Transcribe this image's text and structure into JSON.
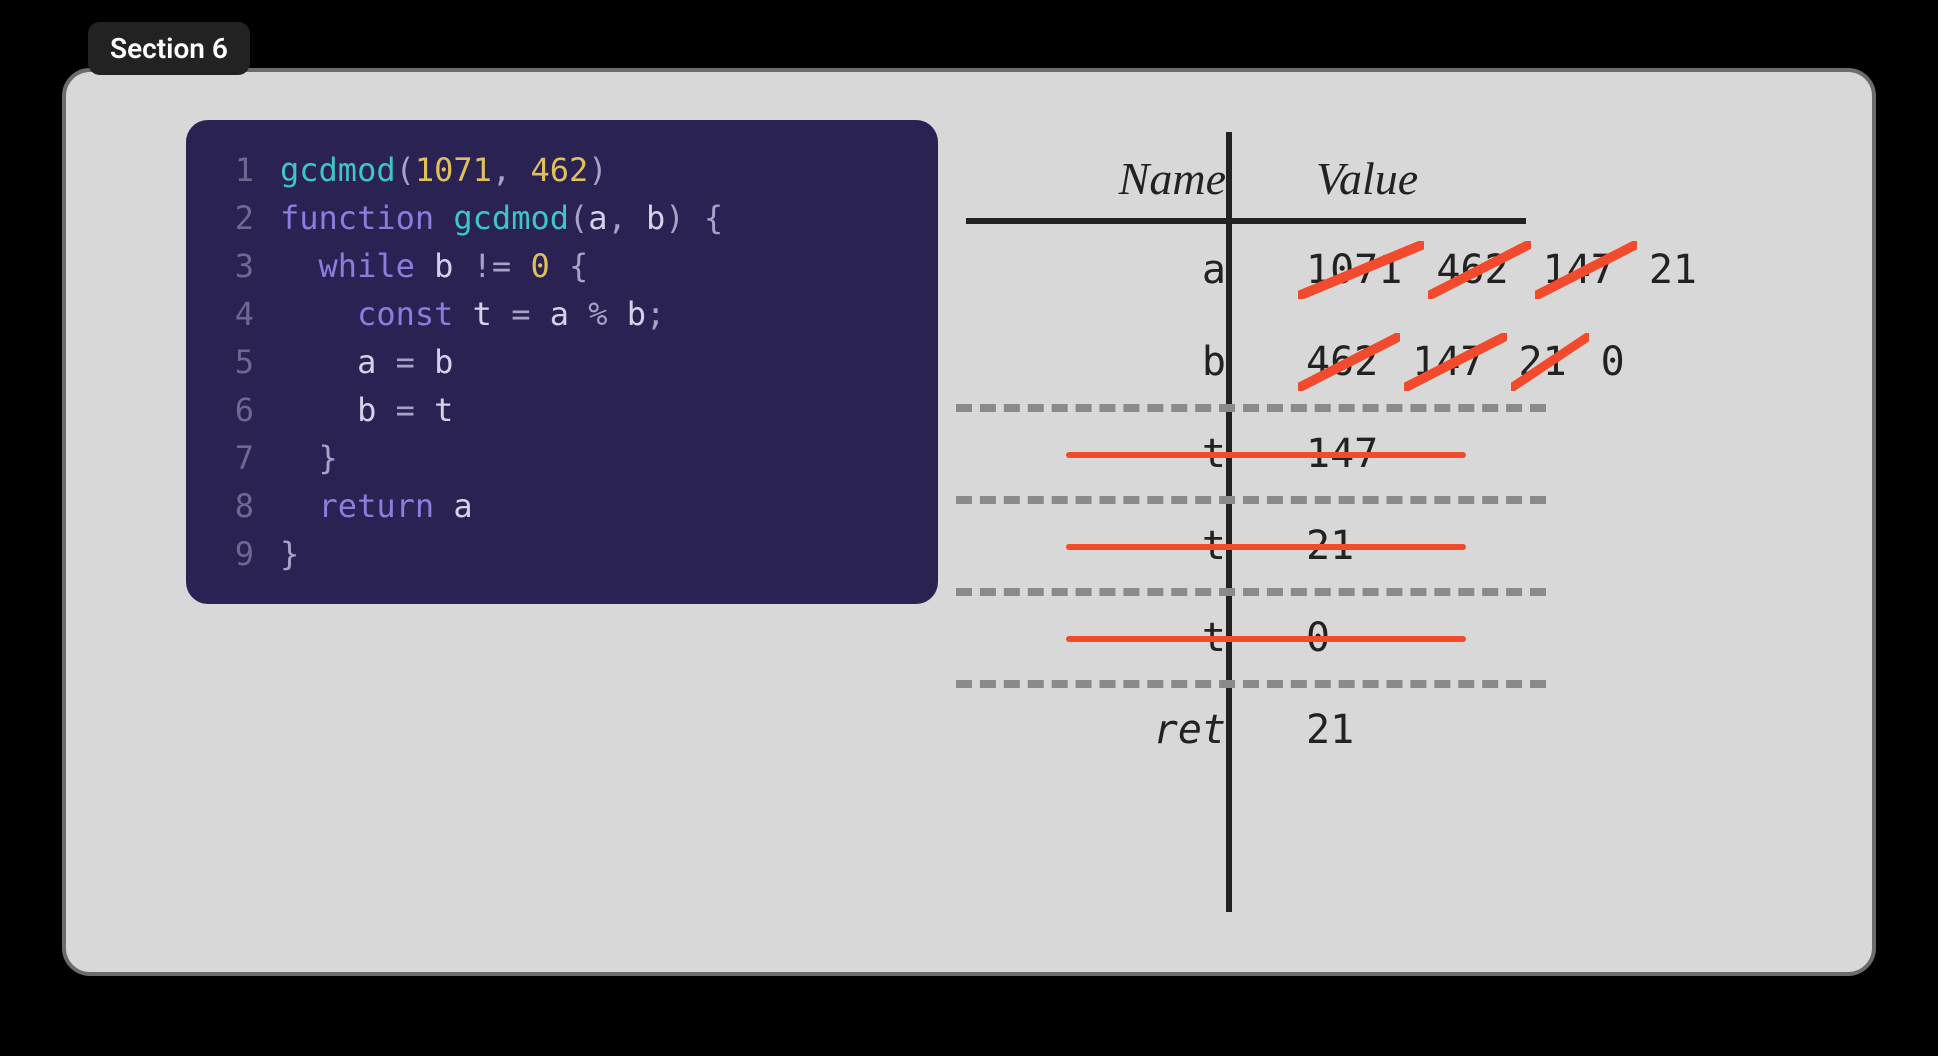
{
  "tab": "Section 6",
  "code": {
    "lines": [
      {
        "n": "1",
        "tokens": [
          {
            "t": "gcdmod",
            "c": "tok-call"
          },
          {
            "t": "(",
            "c": "tok-punc"
          },
          {
            "t": "1071",
            "c": "tok-num"
          },
          {
            "t": ", ",
            "c": "tok-punc"
          },
          {
            "t": "462",
            "c": "tok-num"
          },
          {
            "t": ")",
            "c": "tok-punc"
          }
        ]
      },
      {
        "n": "2",
        "tokens": [
          {
            "t": "function ",
            "c": "tok-kw"
          },
          {
            "t": "gcdmod",
            "c": "tok-call"
          },
          {
            "t": "(",
            "c": "tok-punc"
          },
          {
            "t": "a",
            "c": "tok-id"
          },
          {
            "t": ", ",
            "c": "tok-punc"
          },
          {
            "t": "b",
            "c": "tok-id"
          },
          {
            "t": ") {",
            "c": "tok-punc"
          }
        ]
      },
      {
        "n": "3",
        "tokens": [
          {
            "t": "  ",
            "c": ""
          },
          {
            "t": "while ",
            "c": "tok-kw"
          },
          {
            "t": "b ",
            "c": "tok-id"
          },
          {
            "t": "!= ",
            "c": "tok-op"
          },
          {
            "t": "0 ",
            "c": "tok-num"
          },
          {
            "t": "{",
            "c": "tok-punc"
          }
        ]
      },
      {
        "n": "4",
        "tokens": [
          {
            "t": "    ",
            "c": ""
          },
          {
            "t": "const ",
            "c": "tok-kw"
          },
          {
            "t": "t ",
            "c": "tok-id"
          },
          {
            "t": "= ",
            "c": "tok-op"
          },
          {
            "t": "a ",
            "c": "tok-id"
          },
          {
            "t": "% ",
            "c": "tok-op"
          },
          {
            "t": "b",
            "c": "tok-id"
          },
          {
            "t": ";",
            "c": "tok-punc"
          }
        ]
      },
      {
        "n": "5",
        "tokens": [
          {
            "t": "    ",
            "c": ""
          },
          {
            "t": "a ",
            "c": "tok-id"
          },
          {
            "t": "= ",
            "c": "tok-op"
          },
          {
            "t": "b",
            "c": "tok-id"
          }
        ]
      },
      {
        "n": "6",
        "tokens": [
          {
            "t": "    ",
            "c": ""
          },
          {
            "t": "b ",
            "c": "tok-id"
          },
          {
            "t": "= ",
            "c": "tok-op"
          },
          {
            "t": "t",
            "c": "tok-id"
          }
        ]
      },
      {
        "n": "7",
        "tokens": [
          {
            "t": "  }",
            "c": "tok-punc"
          }
        ]
      },
      {
        "n": "8",
        "tokens": [
          {
            "t": "  ",
            "c": ""
          },
          {
            "t": "return ",
            "c": "tok-kw"
          },
          {
            "t": "a",
            "c": "tok-id"
          }
        ]
      },
      {
        "n": "9",
        "tokens": [
          {
            "t": "}",
            "c": "tok-punc"
          }
        ]
      }
    ]
  },
  "table": {
    "head_name": "Name",
    "head_value": "Value",
    "rows": [
      {
        "name": "a",
        "values": [
          {
            "v": "1071",
            "struck": true
          },
          {
            "v": "462",
            "struck": true
          },
          {
            "v": "147",
            "struck": true
          },
          {
            "v": "21",
            "struck": false
          }
        ]
      },
      {
        "name": "b",
        "values": [
          {
            "v": "462",
            "struck": true
          },
          {
            "v": "147",
            "struck": true
          },
          {
            "v": "21",
            "struck": true
          },
          {
            "v": "0",
            "struck": false
          }
        ]
      },
      {
        "name": "t",
        "row_struck": true,
        "values": [
          {
            "v": "147",
            "struck": false
          }
        ]
      },
      {
        "name": "t",
        "row_struck": true,
        "values": [
          {
            "v": "21",
            "struck": false
          }
        ]
      },
      {
        "name": "t",
        "row_struck": true,
        "values": [
          {
            "v": "0",
            "struck": false
          }
        ]
      },
      {
        "name": "ret",
        "ret": true,
        "values": [
          {
            "v": "21",
            "struck": false
          }
        ]
      }
    ]
  }
}
